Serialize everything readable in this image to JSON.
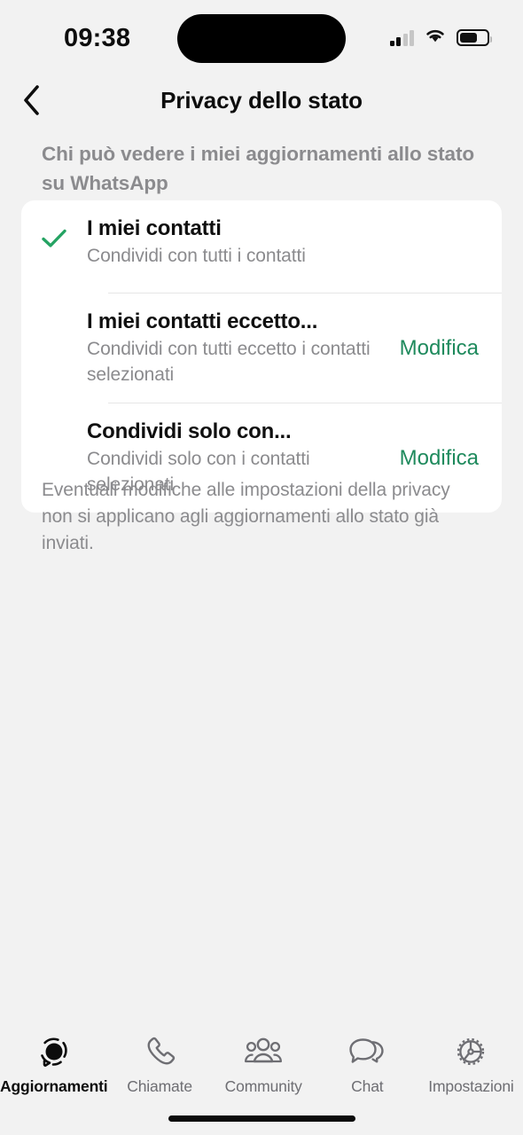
{
  "colors": {
    "background": "#f2f2f2",
    "card": "#ffffff",
    "accent_green": "#1f8a5d",
    "check_green": "#25a363",
    "secondary_text": "#8b8b8e",
    "primary_text": "#0d0d0d"
  },
  "status_bar": {
    "time": "09:38",
    "cellular_icon": "cellular-signal-icon",
    "cellular_bars_filled": 2,
    "cellular_bars_total": 4,
    "wifi_icon": "wifi-icon",
    "battery_icon": "battery-icon",
    "battery_level_percent": 60
  },
  "nav": {
    "back_icon": "chevron-left-icon",
    "title": "Privacy dello stato"
  },
  "section": {
    "header": "Chi può vedere i miei aggiornamenti allo stato su WhatsApp"
  },
  "options": [
    {
      "title": "I miei contatti",
      "subtitle": "Condividi con tutti i contatti",
      "selected": true,
      "check_icon": "checkmark-icon",
      "action": ""
    },
    {
      "title": "I miei contatti eccetto...",
      "subtitle": "Condividi con tutti eccetto i contatti selezionati",
      "selected": false,
      "check_icon": "",
      "action": "Modifica"
    },
    {
      "title": "Condividi solo con...",
      "subtitle": "Condividi solo con i contatti selezionati",
      "selected": false,
      "check_icon": "",
      "action": "Modifica"
    }
  ],
  "footer_note": "Eventuali modifiche alle impostazioni della privacy non si applicano agli aggiornamenti allo stato già inviati.",
  "tabs": [
    {
      "label": "Aggiornamenti",
      "icon": "status-updates-icon",
      "active": true
    },
    {
      "label": "Chiamate",
      "icon": "phone-icon",
      "active": false
    },
    {
      "label": "Community",
      "icon": "community-people-icon",
      "active": false
    },
    {
      "label": "Chat",
      "icon": "chat-bubbles-icon",
      "active": false
    },
    {
      "label": "Impostazioni",
      "icon": "gear-icon",
      "active": false
    }
  ]
}
